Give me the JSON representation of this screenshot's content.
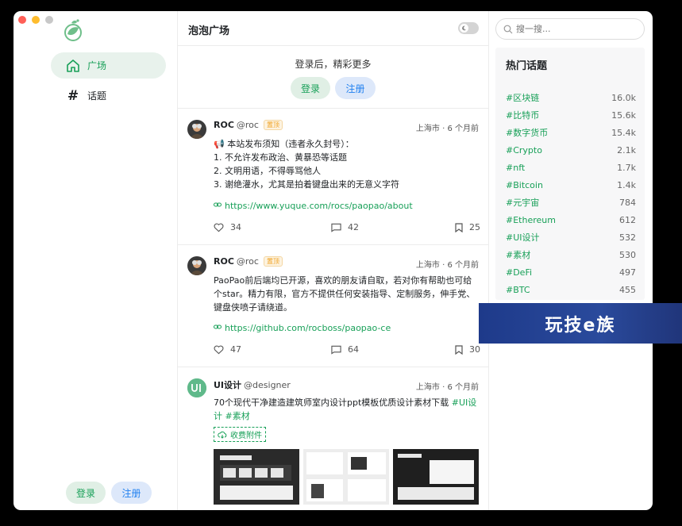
{
  "app": {
    "title": "泡泡广场"
  },
  "traffic_lights": [
    "#ff5f57",
    "#febc2e",
    "#c8c8c8"
  ],
  "nav": [
    {
      "label": "广场",
      "icon": "home-icon",
      "active": true
    },
    {
      "label": "话题",
      "icon": "hash-icon",
      "active": false
    }
  ],
  "sidebar_buttons": {
    "login": "登录",
    "register": "注册"
  },
  "login_prompt": {
    "hint": "登录后，精彩更多",
    "login": "登录",
    "register": "注册"
  },
  "posts": [
    {
      "nickname": "ROC",
      "username": "@roc",
      "badge": "置顶",
      "time": "上海市 · 6 个月前",
      "lines": [
        "📢 本站发布须知（违者永久封号）：",
        "1. 不允许发布政治、黄暴恐等话题",
        "2. 文明用语，不得辱骂他人",
        "3. 谢绝灌水，尤其是拍着键盘出来的无意义字符"
      ],
      "link": "https://www.yuque.com/rocs/paopao/about",
      "likes": "34",
      "comments": "42",
      "collections": "25"
    },
    {
      "nickname": "ROC",
      "username": "@roc",
      "badge": "置顶",
      "time": "上海市 · 6 个月前",
      "lines": [
        "PaoPao前后端均已开源，喜欢的朋友请自取，若对你有帮助也可给",
        "个star。精力有限，官方不提供任何安装指导、定制服务，伸手党、",
        "键盘侠喷子请绕道。"
      ],
      "link": "https://github.com/rocboss/paopao-ce",
      "likes": "47",
      "comments": "64",
      "collections": "30"
    },
    {
      "nickname": "UI设计",
      "username": "@designer",
      "time": "上海市 · 6 个月前",
      "text": "70个现代干净建造建筑师室内设计ppt模板优质设计素材下载 ",
      "tag1": "#UI设",
      "text2": "计",
      "tag2": " #素材",
      "attachment": "收费附件"
    }
  ],
  "search": {
    "placeholder": "搜一搜..."
  },
  "hot_topics": {
    "title": "热门话题",
    "items": [
      {
        "name": "#区块链",
        "count": "16.0k"
      },
      {
        "name": "#比特币",
        "count": "15.6k"
      },
      {
        "name": "#数字货币",
        "count": "15.4k"
      },
      {
        "name": "#Crypto",
        "count": "2.1k"
      },
      {
        "name": "#nft",
        "count": "1.7k"
      },
      {
        "name": "#Bitcoin",
        "count": "1.4k"
      },
      {
        "name": "#元宇宙",
        "count": "784"
      },
      {
        "name": "#Ethereum",
        "count": "612"
      },
      {
        "name": "#UI设计",
        "count": "532"
      },
      {
        "name": "#素材",
        "count": "530"
      },
      {
        "name": "#DeFi",
        "count": "497"
      },
      {
        "name": "#BTC",
        "count": "455"
      }
    ]
  },
  "watermark": "玩技e族",
  "colors": {
    "accent": "#18a058",
    "info": "#2080f0"
  }
}
